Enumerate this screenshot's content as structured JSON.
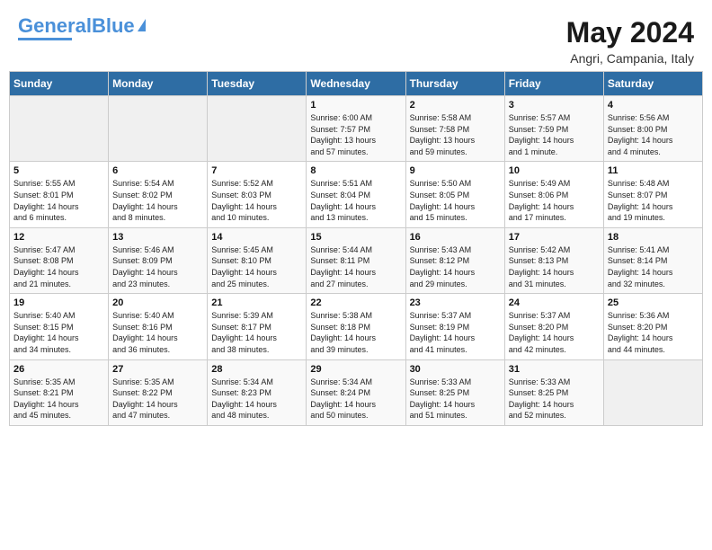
{
  "header": {
    "logo_text1": "General",
    "logo_text2": "Blue",
    "main_title": "May 2024",
    "subtitle": "Angri, Campania, Italy"
  },
  "days_of_week": [
    "Sunday",
    "Monday",
    "Tuesday",
    "Wednesday",
    "Thursday",
    "Friday",
    "Saturday"
  ],
  "weeks": [
    [
      {
        "day": "",
        "info": ""
      },
      {
        "day": "",
        "info": ""
      },
      {
        "day": "",
        "info": ""
      },
      {
        "day": "1",
        "info": "Sunrise: 6:00 AM\nSunset: 7:57 PM\nDaylight: 13 hours\nand 57 minutes."
      },
      {
        "day": "2",
        "info": "Sunrise: 5:58 AM\nSunset: 7:58 PM\nDaylight: 13 hours\nand 59 minutes."
      },
      {
        "day": "3",
        "info": "Sunrise: 5:57 AM\nSunset: 7:59 PM\nDaylight: 14 hours\nand 1 minute."
      },
      {
        "day": "4",
        "info": "Sunrise: 5:56 AM\nSunset: 8:00 PM\nDaylight: 14 hours\nand 4 minutes."
      }
    ],
    [
      {
        "day": "5",
        "info": "Sunrise: 5:55 AM\nSunset: 8:01 PM\nDaylight: 14 hours\nand 6 minutes."
      },
      {
        "day": "6",
        "info": "Sunrise: 5:54 AM\nSunset: 8:02 PM\nDaylight: 14 hours\nand 8 minutes."
      },
      {
        "day": "7",
        "info": "Sunrise: 5:52 AM\nSunset: 8:03 PM\nDaylight: 14 hours\nand 10 minutes."
      },
      {
        "day": "8",
        "info": "Sunrise: 5:51 AM\nSunset: 8:04 PM\nDaylight: 14 hours\nand 13 minutes."
      },
      {
        "day": "9",
        "info": "Sunrise: 5:50 AM\nSunset: 8:05 PM\nDaylight: 14 hours\nand 15 minutes."
      },
      {
        "day": "10",
        "info": "Sunrise: 5:49 AM\nSunset: 8:06 PM\nDaylight: 14 hours\nand 17 minutes."
      },
      {
        "day": "11",
        "info": "Sunrise: 5:48 AM\nSunset: 8:07 PM\nDaylight: 14 hours\nand 19 minutes."
      }
    ],
    [
      {
        "day": "12",
        "info": "Sunrise: 5:47 AM\nSunset: 8:08 PM\nDaylight: 14 hours\nand 21 minutes."
      },
      {
        "day": "13",
        "info": "Sunrise: 5:46 AM\nSunset: 8:09 PM\nDaylight: 14 hours\nand 23 minutes."
      },
      {
        "day": "14",
        "info": "Sunrise: 5:45 AM\nSunset: 8:10 PM\nDaylight: 14 hours\nand 25 minutes."
      },
      {
        "day": "15",
        "info": "Sunrise: 5:44 AM\nSunset: 8:11 PM\nDaylight: 14 hours\nand 27 minutes."
      },
      {
        "day": "16",
        "info": "Sunrise: 5:43 AM\nSunset: 8:12 PM\nDaylight: 14 hours\nand 29 minutes."
      },
      {
        "day": "17",
        "info": "Sunrise: 5:42 AM\nSunset: 8:13 PM\nDaylight: 14 hours\nand 31 minutes."
      },
      {
        "day": "18",
        "info": "Sunrise: 5:41 AM\nSunset: 8:14 PM\nDaylight: 14 hours\nand 32 minutes."
      }
    ],
    [
      {
        "day": "19",
        "info": "Sunrise: 5:40 AM\nSunset: 8:15 PM\nDaylight: 14 hours\nand 34 minutes."
      },
      {
        "day": "20",
        "info": "Sunrise: 5:40 AM\nSunset: 8:16 PM\nDaylight: 14 hours\nand 36 minutes."
      },
      {
        "day": "21",
        "info": "Sunrise: 5:39 AM\nSunset: 8:17 PM\nDaylight: 14 hours\nand 38 minutes."
      },
      {
        "day": "22",
        "info": "Sunrise: 5:38 AM\nSunset: 8:18 PM\nDaylight: 14 hours\nand 39 minutes."
      },
      {
        "day": "23",
        "info": "Sunrise: 5:37 AM\nSunset: 8:19 PM\nDaylight: 14 hours\nand 41 minutes."
      },
      {
        "day": "24",
        "info": "Sunrise: 5:37 AM\nSunset: 8:20 PM\nDaylight: 14 hours\nand 42 minutes."
      },
      {
        "day": "25",
        "info": "Sunrise: 5:36 AM\nSunset: 8:20 PM\nDaylight: 14 hours\nand 44 minutes."
      }
    ],
    [
      {
        "day": "26",
        "info": "Sunrise: 5:35 AM\nSunset: 8:21 PM\nDaylight: 14 hours\nand 45 minutes."
      },
      {
        "day": "27",
        "info": "Sunrise: 5:35 AM\nSunset: 8:22 PM\nDaylight: 14 hours\nand 47 minutes."
      },
      {
        "day": "28",
        "info": "Sunrise: 5:34 AM\nSunset: 8:23 PM\nDaylight: 14 hours\nand 48 minutes."
      },
      {
        "day": "29",
        "info": "Sunrise: 5:34 AM\nSunset: 8:24 PM\nDaylight: 14 hours\nand 50 minutes."
      },
      {
        "day": "30",
        "info": "Sunrise: 5:33 AM\nSunset: 8:25 PM\nDaylight: 14 hours\nand 51 minutes."
      },
      {
        "day": "31",
        "info": "Sunrise: 5:33 AM\nSunset: 8:25 PM\nDaylight: 14 hours\nand 52 minutes."
      },
      {
        "day": "",
        "info": ""
      }
    ]
  ]
}
